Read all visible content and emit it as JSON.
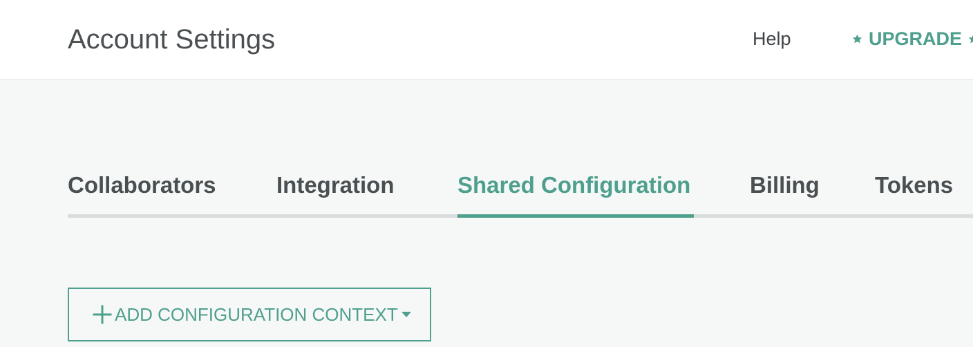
{
  "header": {
    "title": "Account Settings",
    "help_label": "Help",
    "upgrade_label": "UPGRADE"
  },
  "tabs": [
    {
      "label": "Collaborators",
      "active": false
    },
    {
      "label": "Integration",
      "active": false
    },
    {
      "label": "Shared Configuration",
      "active": true
    },
    {
      "label": "Billing",
      "active": false
    },
    {
      "label": "Tokens",
      "active": false
    }
  ],
  "actions": {
    "add_context_label": "ADD CONFIGURATION CONTEXT"
  },
  "icons": {
    "upgrade_left": "star-icon",
    "upgrade_right": "star-icon",
    "add": "plus-icon",
    "dropdown": "caret-down-icon"
  },
  "colors": {
    "accent": "#4f9f8e",
    "text": "#4a4f52",
    "background": "#f5f8f7",
    "header_background": "#ffffff",
    "tab_rail": "#dadddc"
  }
}
